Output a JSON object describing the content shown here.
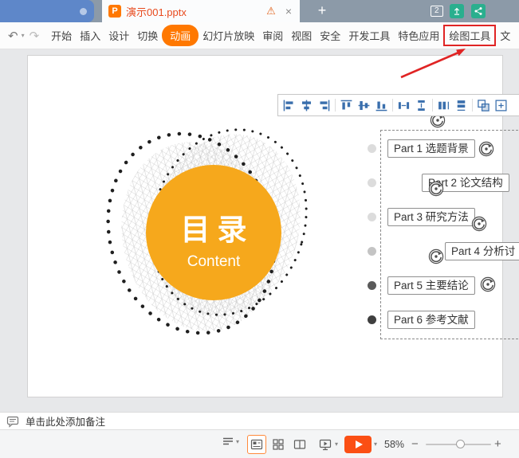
{
  "titlebar": {
    "tab_title": "演示001.pptx",
    "doc_icon_letter": "P",
    "warning_icon": "⚠",
    "tab_close_icon": "×",
    "new_tab_icon": "+",
    "badge_count": "2"
  },
  "menubar": {
    "undo_icon": "↶",
    "redo_icon": "↷",
    "caret_icon": "▾",
    "items": [
      {
        "label": "开始"
      },
      {
        "label": "插入"
      },
      {
        "label": "设计"
      },
      {
        "label": "切换"
      },
      {
        "label": "动画",
        "highlight": "orange-pill"
      },
      {
        "label": "幻灯片放映"
      },
      {
        "label": "审阅"
      },
      {
        "label": "视图"
      },
      {
        "label": "安全"
      },
      {
        "label": "开发工具"
      },
      {
        "label": "特色应用"
      },
      {
        "label": "绘图工具",
        "highlight": "red-box"
      },
      {
        "label": "文"
      }
    ]
  },
  "align_toolbar": {
    "icons": [
      "align-left",
      "align-center-horizontal",
      "align-right",
      "align-top",
      "align-middle-vertical",
      "align-bottom",
      "distribute-horizontally",
      "distribute-vertically",
      "equal-height",
      "equal-width",
      "group",
      "more"
    ]
  },
  "slide": {
    "center_title": "目录",
    "center_subtitle": "Content",
    "toc_items": [
      {
        "label": "Part 1 选题背景"
      },
      {
        "label": "Part 2 论文结构"
      },
      {
        "label": "Part 3 研究方法"
      },
      {
        "label": "Part 4 分析讨"
      },
      {
        "label": "Part 5 主要结论"
      },
      {
        "label": "Part 6 参考文献"
      }
    ]
  },
  "notes_bar": {
    "placeholder": "单击此处添加备注"
  },
  "status_bar": {
    "zoom_level": "58%",
    "zoom_out_icon": "−",
    "zoom_in_icon": "+",
    "caret_icon": "▾"
  },
  "colors": {
    "accent_orange": "#ff7800",
    "play_button_orange": "#fb4f14",
    "circle_orange": "#f6a81c",
    "highlight_red": "#e02424",
    "toolbar_icon_blue": "#3a6fad",
    "titlebar_gray_blue": "#8c9aa8",
    "home_pill_blue": "#5e87c9"
  }
}
